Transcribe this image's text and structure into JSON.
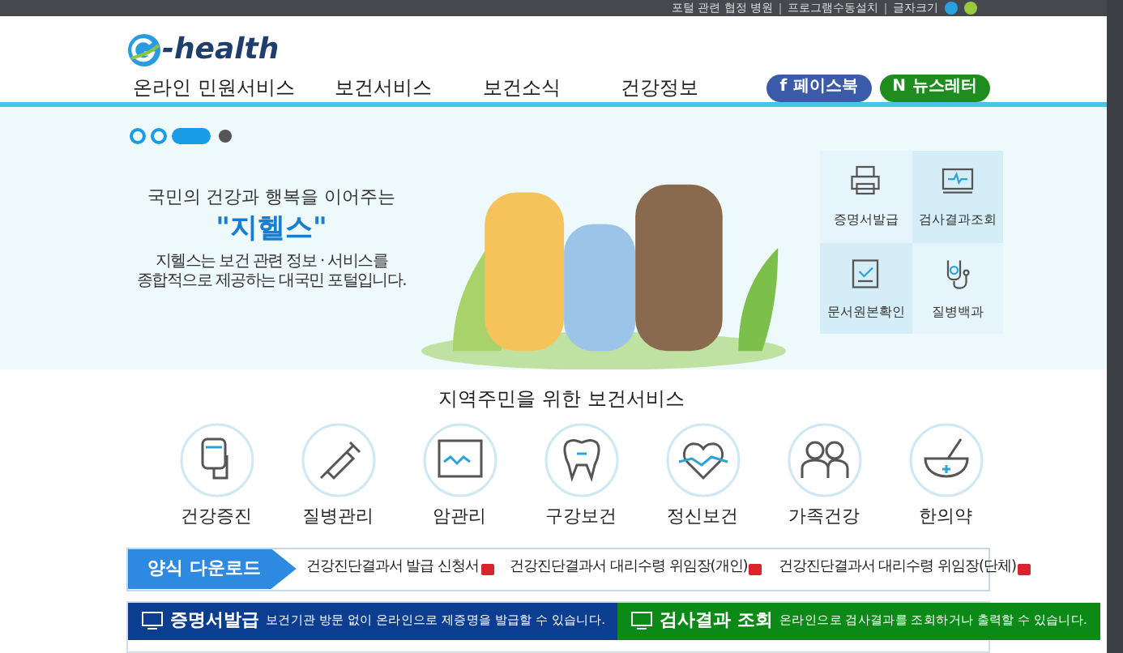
{
  "top_bar": {
    "links": [
      "포털 관련 협정 병원",
      "프로그램수동설치",
      "글자크기"
    ]
  },
  "header": {
    "logo": "-health",
    "nav": [
      "온라인 민원서비스",
      "보건서비스",
      "보건소식",
      "건강정보"
    ],
    "social": [
      {
        "label": "페이스북",
        "kind": "facebook",
        "icon": "f"
      },
      {
        "label": "뉴스레터",
        "kind": "newsletter",
        "icon": "N"
      }
    ]
  },
  "hero": {
    "slides": [
      {
        "selected": false
      },
      {
        "selected": false
      },
      {
        "selected": true
      }
    ],
    "tagline": "국민의 건강과 행복을 이어주는",
    "brand": "\"지헬스\"",
    "description": [
      "지헬스는 보건 관련 정보 · 서비스를",
      "종합적으로 제공하는 대국민 포털입니다."
    ],
    "quick_links": [
      {
        "label": "증명서발급",
        "kind": "printer"
      },
      {
        "label": "검사결과조회",
        "kind": "monitor"
      },
      {
        "label": "문서원본확인",
        "kind": "document"
      },
      {
        "label": "질병백과",
        "kind": "stethoscope"
      }
    ]
  },
  "services": {
    "title": "지역주민을 위한 보건서비스",
    "items": [
      {
        "label": "건강증진",
        "kind": "iv"
      },
      {
        "label": "질병관리",
        "kind": "syringe"
      },
      {
        "label": "암관리",
        "kind": "chart"
      },
      {
        "label": "구강보건",
        "kind": "tooth"
      },
      {
        "label": "정신보건",
        "kind": "heart"
      },
      {
        "label": "가족건강",
        "kind": "family"
      },
      {
        "label": "한의약",
        "kind": "mortar"
      }
    ]
  },
  "downloads": {
    "title": "양식 다운로드",
    "items": [
      "건강진단결과서 발급 신청서",
      "건강진단결과서 대리수령 위임장(개인)",
      "건강진단결과서 대리수령 위임장(단체)"
    ]
  },
  "panels": [
    {
      "title": "증명서발급",
      "description": "보건기관 방문 없이 온라인으로 제증명을 발급할 수 있습니다.",
      "color": "#0b3d91"
    },
    {
      "title": "검사결과 조회",
      "description": "온라인으로 검사결과를 조회하거나 출력할 수 있습니다.",
      "color": "#0b8a17"
    }
  ]
}
